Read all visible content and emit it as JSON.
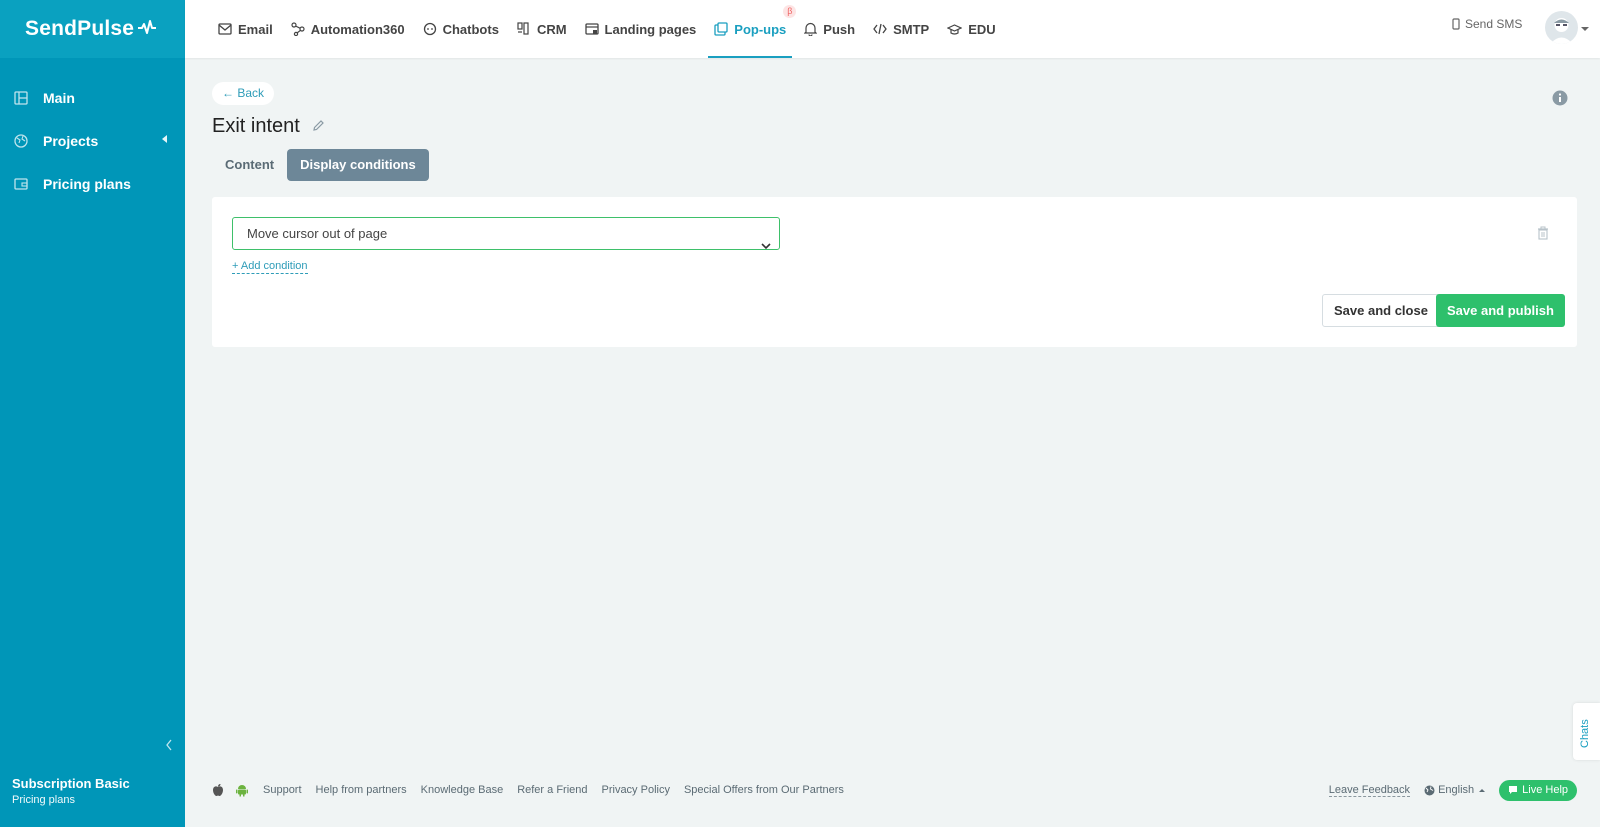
{
  "brand": {
    "name": "SendPulse"
  },
  "sidebar": {
    "items": [
      {
        "label": "Main",
        "icon": "dashboard-icon"
      },
      {
        "label": "Projects",
        "icon": "globe-icon"
      },
      {
        "label": "Pricing plans",
        "icon": "wallet-icon"
      }
    ],
    "plan_title": "Subscription Basic",
    "plan_link": "Pricing plans"
  },
  "topnav": {
    "items": [
      {
        "label": "Email",
        "icon": "envelope-icon"
      },
      {
        "label": "Automation360",
        "icon": "automation-icon"
      },
      {
        "label": "Chatbots",
        "icon": "chatbot-icon"
      },
      {
        "label": "CRM",
        "icon": "crm-icon"
      },
      {
        "label": "Landing pages",
        "icon": "landing-icon"
      },
      {
        "label": "Pop-ups",
        "icon": "popup-icon",
        "active": true,
        "badge": "β"
      },
      {
        "label": "Push",
        "icon": "bell-icon"
      },
      {
        "label": "SMTP",
        "icon": "code-icon"
      },
      {
        "label": "EDU",
        "icon": "graduation-cap-icon"
      }
    ],
    "send_sms": "Send SMS"
  },
  "page": {
    "back": "← Back",
    "title": "Exit intent",
    "tabs": [
      {
        "label": "Content",
        "active": false
      },
      {
        "label": "Display conditions",
        "active": true
      }
    ]
  },
  "condition": {
    "selected": "Move cursor out of page",
    "add_condition": "+ Add condition",
    "save_close": "Save and close",
    "save_publish": "Save and publish"
  },
  "footer": {
    "links": [
      "Support",
      "Help from partners",
      "Knowledge Base",
      "Refer a Friend",
      "Privacy Policy",
      "Special Offers from Our Partners"
    ],
    "leave_feedback": "Leave Feedback",
    "language": "English",
    "live_help": "Live Help"
  },
  "chats_tab": "Chats",
  "colors": {
    "sidebar": "#0096b8",
    "accent": "#1a9fc0",
    "primary_button": "#2ec06c",
    "active_tab": "#6d8798"
  }
}
